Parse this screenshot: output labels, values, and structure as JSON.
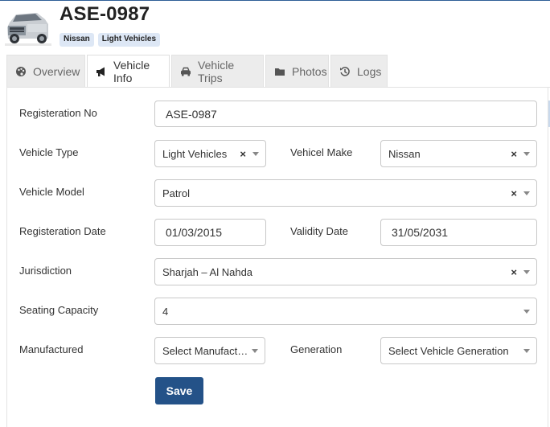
{
  "header": {
    "title": "ASE-0987",
    "badges": [
      "Nissan",
      "Light Vehicles"
    ]
  },
  "tabs": [
    {
      "label": "Overview",
      "icon": "palette-icon",
      "active": false
    },
    {
      "label": "Vehicle Info",
      "icon": "megaphone-icon",
      "active": true
    },
    {
      "label": "Vehicle Trips",
      "icon": "car-icon",
      "active": false
    },
    {
      "label": "Photos",
      "icon": "folder-icon",
      "active": false
    },
    {
      "label": "Logs",
      "icon": "history-icon",
      "active": false
    }
  ],
  "form": {
    "registration_no": {
      "label": "Registeration No",
      "value": "ASE-0987"
    },
    "vehicle_type": {
      "label": "Vehicle Type",
      "value": "Light Vehicles"
    },
    "vehicle_make": {
      "label": "Vehicel Make",
      "value": "Nissan"
    },
    "vehicle_model": {
      "label": "Vehicle Model",
      "value": "Patrol"
    },
    "registration_date": {
      "label": "Registeration Date",
      "value": "01/03/2015"
    },
    "validity_date": {
      "label": "Validity Date",
      "value": "31/05/2031"
    },
    "jurisdiction": {
      "label": "Jurisdiction",
      "value": "Sharjah – Al Nahda"
    },
    "seating_capacity": {
      "label": "Seating Capacity",
      "value": "4"
    },
    "manufactured": {
      "label": "Manufactured",
      "placeholder": "Select Manufact…"
    },
    "generation": {
      "label": "Generation",
      "placeholder": "Select Vehicle Generation"
    },
    "clear_glyph": "×",
    "save_label": "Save"
  },
  "colors": {
    "accent": "#245288",
    "badge_bg": "#dde7f5",
    "tab_bg": "#ececec"
  }
}
